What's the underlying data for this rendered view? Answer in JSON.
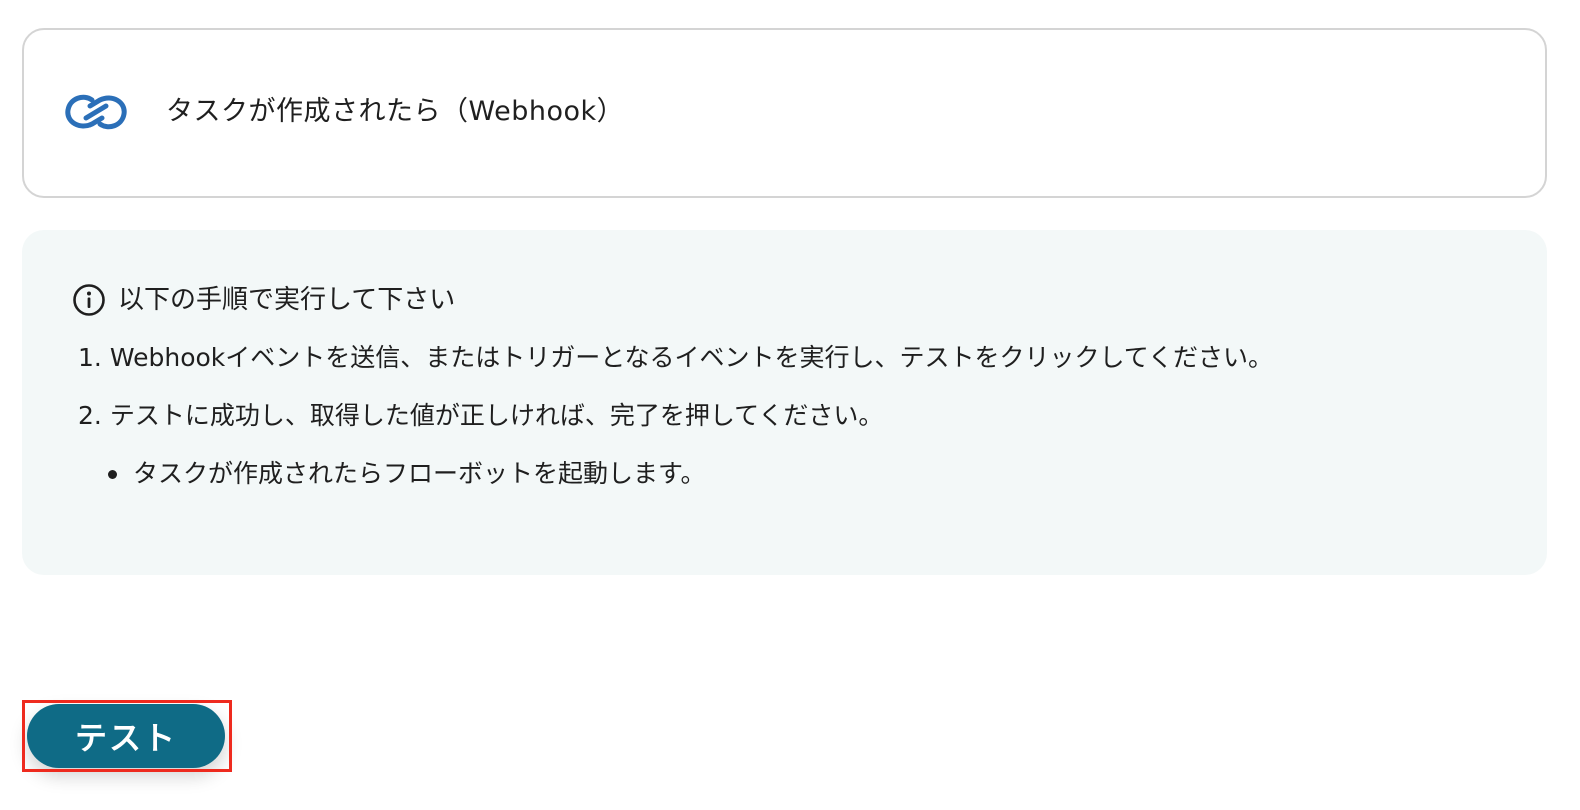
{
  "trigger": {
    "icon": "zoho-connect-icon",
    "icon_color": "#2b6fb8",
    "title": "タスクが作成されたら（Webhook）"
  },
  "instructions": {
    "icon": "info-icon",
    "heading": "以下の手順で実行して下さい",
    "steps": [
      {
        "num": "1.",
        "text": "Webhookイベントを送信、またはトリガーとなるイベントを実行し、テストをクリックしてください。"
      },
      {
        "num": "2.",
        "text": "テストに成功し、取得した値が正しければ、完了を押してください。"
      }
    ],
    "bullets": [
      "タスクが作成されたらフローボットを起動します。"
    ]
  },
  "actions": {
    "test_label": "テスト",
    "button_color": "#0f6b86",
    "highlight_color": "#ee2a1e"
  }
}
